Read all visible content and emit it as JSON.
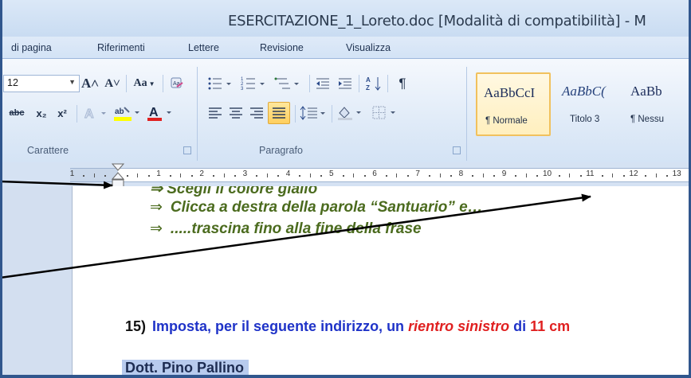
{
  "window": {
    "title": "ESERCITAZIONE_1_Loreto.doc [Modalità di compatibilità]  -  M"
  },
  "ribbon": {
    "tabs": [
      "di pagina",
      "Riferimenti",
      "Lettere",
      "Revisione",
      "Visualizza"
    ],
    "font_group": {
      "font_size": "12",
      "grow_font": "A˄",
      "shrink_font": "A˅",
      "change_case": "Aa",
      "strikethrough": "abc",
      "subscript": "x₂",
      "superscript": "x²",
      "font_color": "A",
      "label": "Carattere"
    },
    "paragraph_group": {
      "label": "Paragrafo",
      "pilcrow": "¶"
    },
    "styles": [
      {
        "sample": "AaBbCcI",
        "name": "¶ Normale"
      },
      {
        "sample": "AaBbC(",
        "name": "Titolo 3"
      },
      {
        "sample": "AaBb",
        "name": "¶ Nessu"
      }
    ]
  },
  "ruler": {
    "labels": [
      "1",
      "1",
      "2",
      "3",
      "4",
      "5",
      "6",
      "7",
      "8",
      "9",
      "10",
      "11",
      "12",
      "13"
    ]
  },
  "document": {
    "partial_line": "⇒ Scegli il colore giallo",
    "arrow_items": [
      "Clicca a destra della parola “Santuario” e…",
      ".....trascina fino alla fine della frase"
    ],
    "arrow_symbol": "⇒",
    "task": {
      "number": "15)",
      "text_before": "Imposta, per il seguente indirizzo, un ",
      "italic_red": "rientro sinistro",
      "text_middle": " di ",
      "red_value": "11 cm"
    },
    "selected_text": "Dott. Pino Pallino"
  },
  "colors": {
    "accent_blue": "#1f33c8",
    "instruction_green": "#4b6b1e",
    "emphasis_red": "#e02020",
    "selection": "#b8cbee",
    "active_style_border": "#f1c15d"
  }
}
